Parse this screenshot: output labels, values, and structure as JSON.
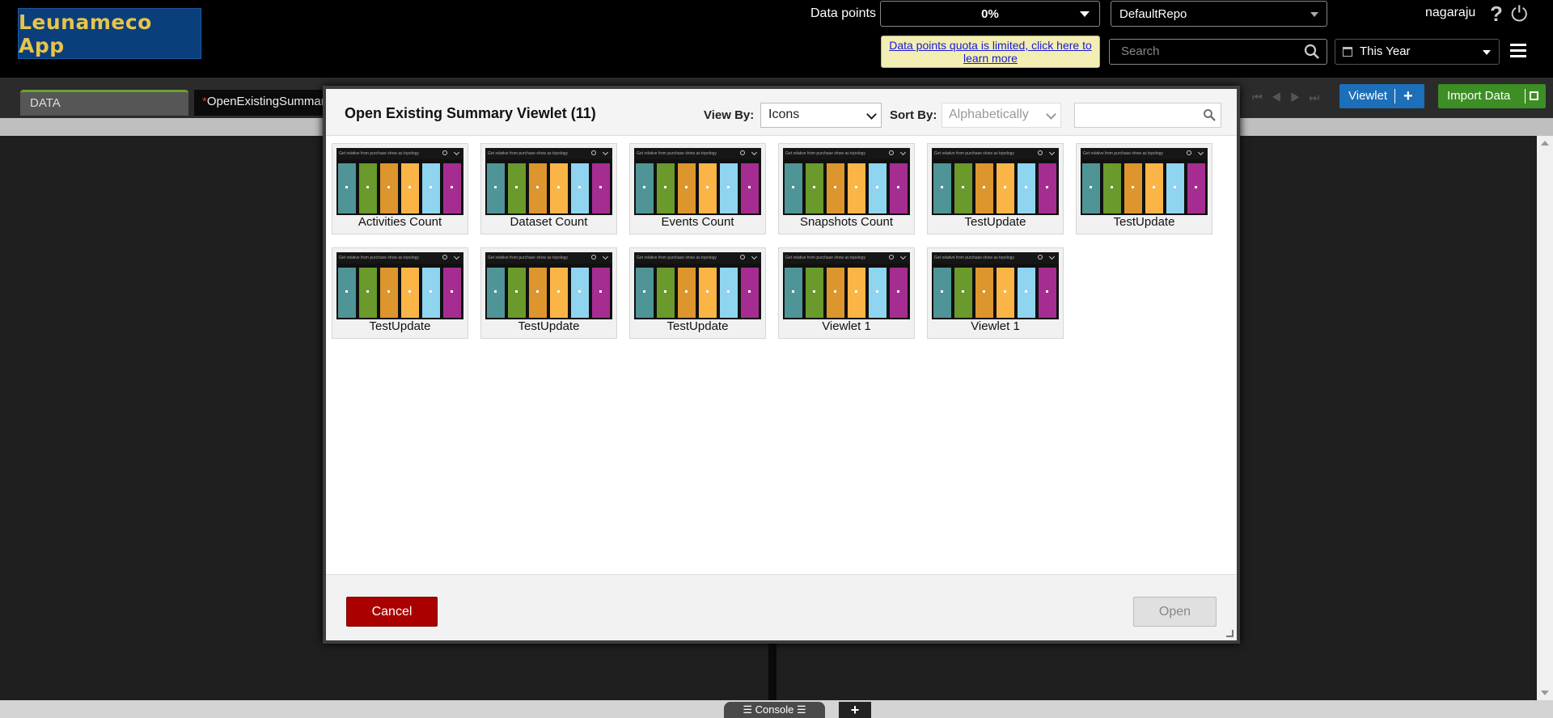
{
  "app": {
    "logo_text": "Leunameco App"
  },
  "header": {
    "data_points_label": "Data points",
    "data_points_value": "0%",
    "repo": "DefaultRepo",
    "username": "nagaraju",
    "quota_notice": "Data points quota is limited, click here to learn more",
    "search_placeholder": "Search",
    "time_range": "This Year",
    "help_glyph": "?",
    "power_glyph": "⏻"
  },
  "tabs": [
    {
      "label": "DATA"
    },
    {
      "label": "OpenExistingSummary",
      "dirty_marker": "*"
    }
  ],
  "toolbar": {
    "viewlet_label": "Viewlet",
    "viewlet_plus": "+",
    "import_label": "Import Data"
  },
  "modal": {
    "title": "Open Existing Summary Viewlet (11)",
    "view_by_label": "View By:",
    "view_by_value": "Icons",
    "sort_by_label": "Sort By:",
    "sort_by_value": "Alphabetically",
    "thumbnail_header_text": "Get relative from purchase show as topology",
    "items": [
      {
        "label": "Activities Count"
      },
      {
        "label": "Dataset Count"
      },
      {
        "label": "Events Count"
      },
      {
        "label": "Snapshots Count"
      },
      {
        "label": "TestUpdate"
      },
      {
        "label": "TestUpdate"
      },
      {
        "label": "TestUpdate"
      },
      {
        "label": "TestUpdate"
      },
      {
        "label": "TestUpdate"
      },
      {
        "label": "Viewlet 1"
      },
      {
        "label": "Viewlet 1"
      }
    ],
    "cancel_label": "Cancel",
    "open_label": "Open"
  },
  "thumbnail_colors": [
    "#4f9597",
    "#6a9a2b",
    "#dd952d",
    "#fbb547",
    "#8fd5ef",
    "#a52d91"
  ],
  "bottom": {
    "console_label": "Console",
    "add_glyph": "+"
  }
}
